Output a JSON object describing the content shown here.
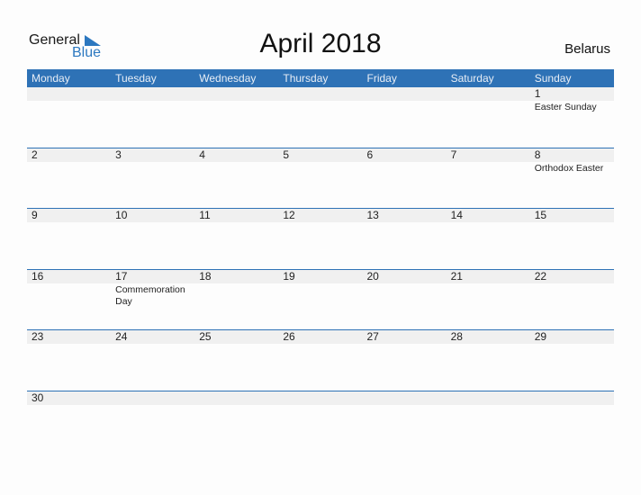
{
  "logo": {
    "line1": "General",
    "line2": "Blue"
  },
  "header": {
    "title": "April 2018",
    "country": "Belarus"
  },
  "colors": {
    "accent": "#2e72b6",
    "band": "#f0f0f0"
  },
  "weekdays": [
    "Monday",
    "Tuesday",
    "Wednesday",
    "Thursday",
    "Friday",
    "Saturday",
    "Sunday"
  ],
  "weeks": [
    [
      {
        "d": ""
      },
      {
        "d": ""
      },
      {
        "d": ""
      },
      {
        "d": ""
      },
      {
        "d": ""
      },
      {
        "d": ""
      },
      {
        "d": "1",
        "h": "Easter Sunday"
      }
    ],
    [
      {
        "d": "2"
      },
      {
        "d": "3"
      },
      {
        "d": "4"
      },
      {
        "d": "5"
      },
      {
        "d": "6"
      },
      {
        "d": "7"
      },
      {
        "d": "8",
        "h": "Orthodox Easter"
      }
    ],
    [
      {
        "d": "9"
      },
      {
        "d": "10"
      },
      {
        "d": "11"
      },
      {
        "d": "12"
      },
      {
        "d": "13"
      },
      {
        "d": "14"
      },
      {
        "d": "15"
      }
    ],
    [
      {
        "d": "16"
      },
      {
        "d": "17",
        "h": "Commemoration Day"
      },
      {
        "d": "18"
      },
      {
        "d": "19"
      },
      {
        "d": "20"
      },
      {
        "d": "21"
      },
      {
        "d": "22"
      }
    ],
    [
      {
        "d": "23"
      },
      {
        "d": "24"
      },
      {
        "d": "25"
      },
      {
        "d": "26"
      },
      {
        "d": "27"
      },
      {
        "d": "28"
      },
      {
        "d": "29"
      }
    ],
    [
      {
        "d": "30"
      },
      {
        "d": ""
      },
      {
        "d": ""
      },
      {
        "d": ""
      },
      {
        "d": ""
      },
      {
        "d": ""
      },
      {
        "d": ""
      }
    ]
  ]
}
